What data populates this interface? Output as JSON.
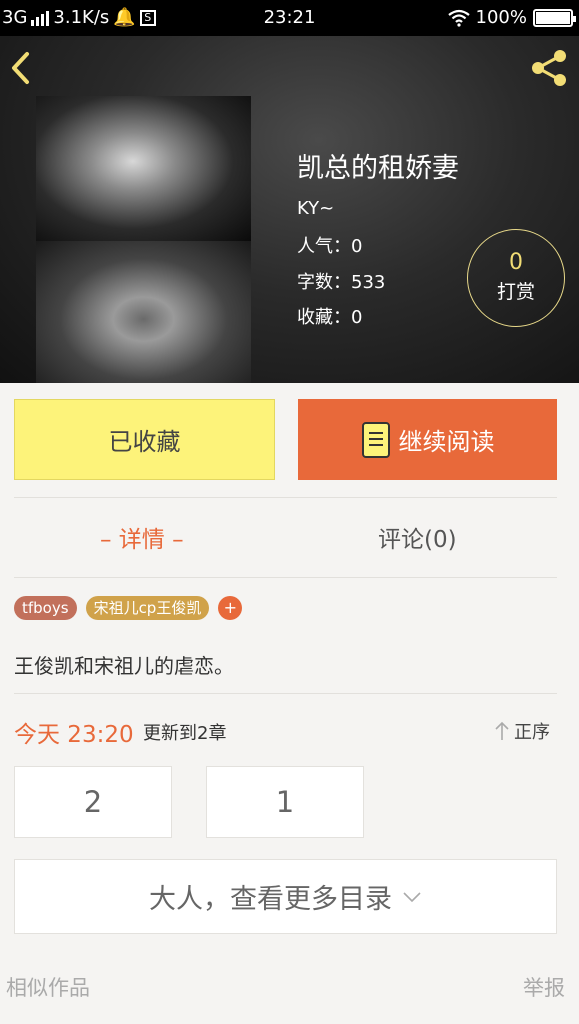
{
  "status_bar": {
    "network": "3G",
    "speed": "3.1K/s",
    "time": "23:21",
    "battery": "100%"
  },
  "book": {
    "title": "凯总的租娇妻",
    "author": "KY~",
    "popularity_label": "人气：",
    "popularity": "0",
    "wordcount_label": "字数：",
    "wordcount": "533",
    "favorites_label": "收藏：",
    "favorites": "0"
  },
  "reward": {
    "count": "0",
    "label": "打赏"
  },
  "actions": {
    "collected_label": "已收藏",
    "continue_label": "继续阅读"
  },
  "tabs": {
    "detail": "– 详情 –",
    "comments": "评论(0)"
  },
  "tags": [
    "tfboys",
    "宋祖儿cp王俊凯"
  ],
  "tag_add": "+",
  "description": "王俊凯和宋祖儿的虐恋。",
  "update": {
    "time": "今天 23:20",
    "chapter_info": "更新到2章",
    "sort_label": "正序"
  },
  "chapters": [
    "2",
    "1"
  ],
  "more_catalog": "大人，查看更多目录",
  "footer": {
    "similar": "相似作品",
    "report": "举报"
  },
  "colors": {
    "accent": "#e8693a",
    "collect_yellow": "#fdf37a",
    "icon_yellow": "#f2dd75"
  }
}
